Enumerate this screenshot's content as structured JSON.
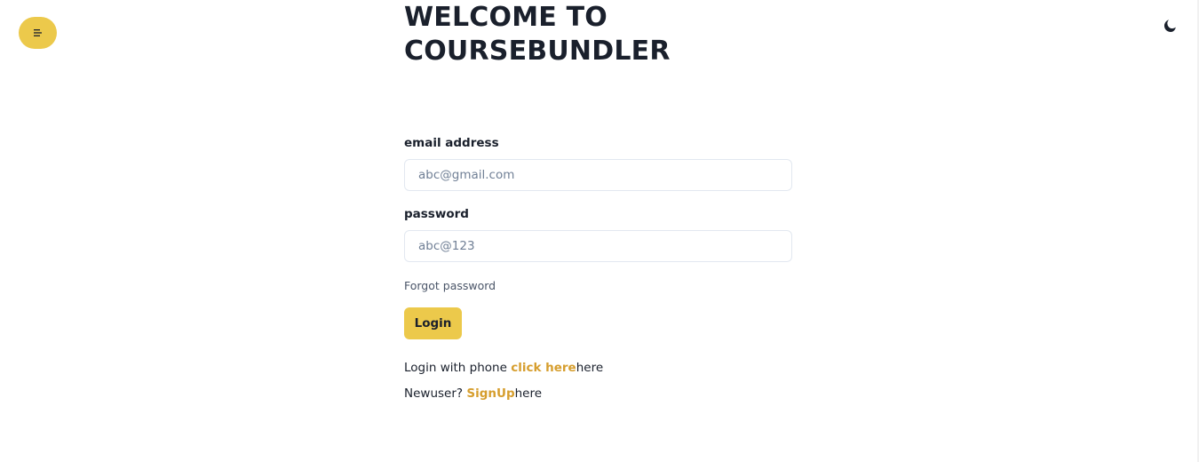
{
  "header": {
    "menu_icon": "hamburger-icon",
    "theme_icon": "moon-icon",
    "accent_color": "#ECC94B",
    "link_color": "#D69E2E"
  },
  "title": {
    "line1": "WELCOME TO",
    "line2": "COURSEBUNDLER"
  },
  "form": {
    "email_label": "email address",
    "email_placeholder": "abc@gmail.com",
    "email_value": "",
    "password_label": "password",
    "password_placeholder": "abc@123",
    "password_value": "",
    "forgot_label": "Forgot password",
    "login_label": "Login"
  },
  "footer_links": {
    "phone_prefix": "Login with phone ",
    "phone_link": "click here",
    "phone_suffix": "here",
    "signup_prefix": "Newuser? ",
    "signup_link": "SignUp",
    "signup_suffix": "here"
  }
}
